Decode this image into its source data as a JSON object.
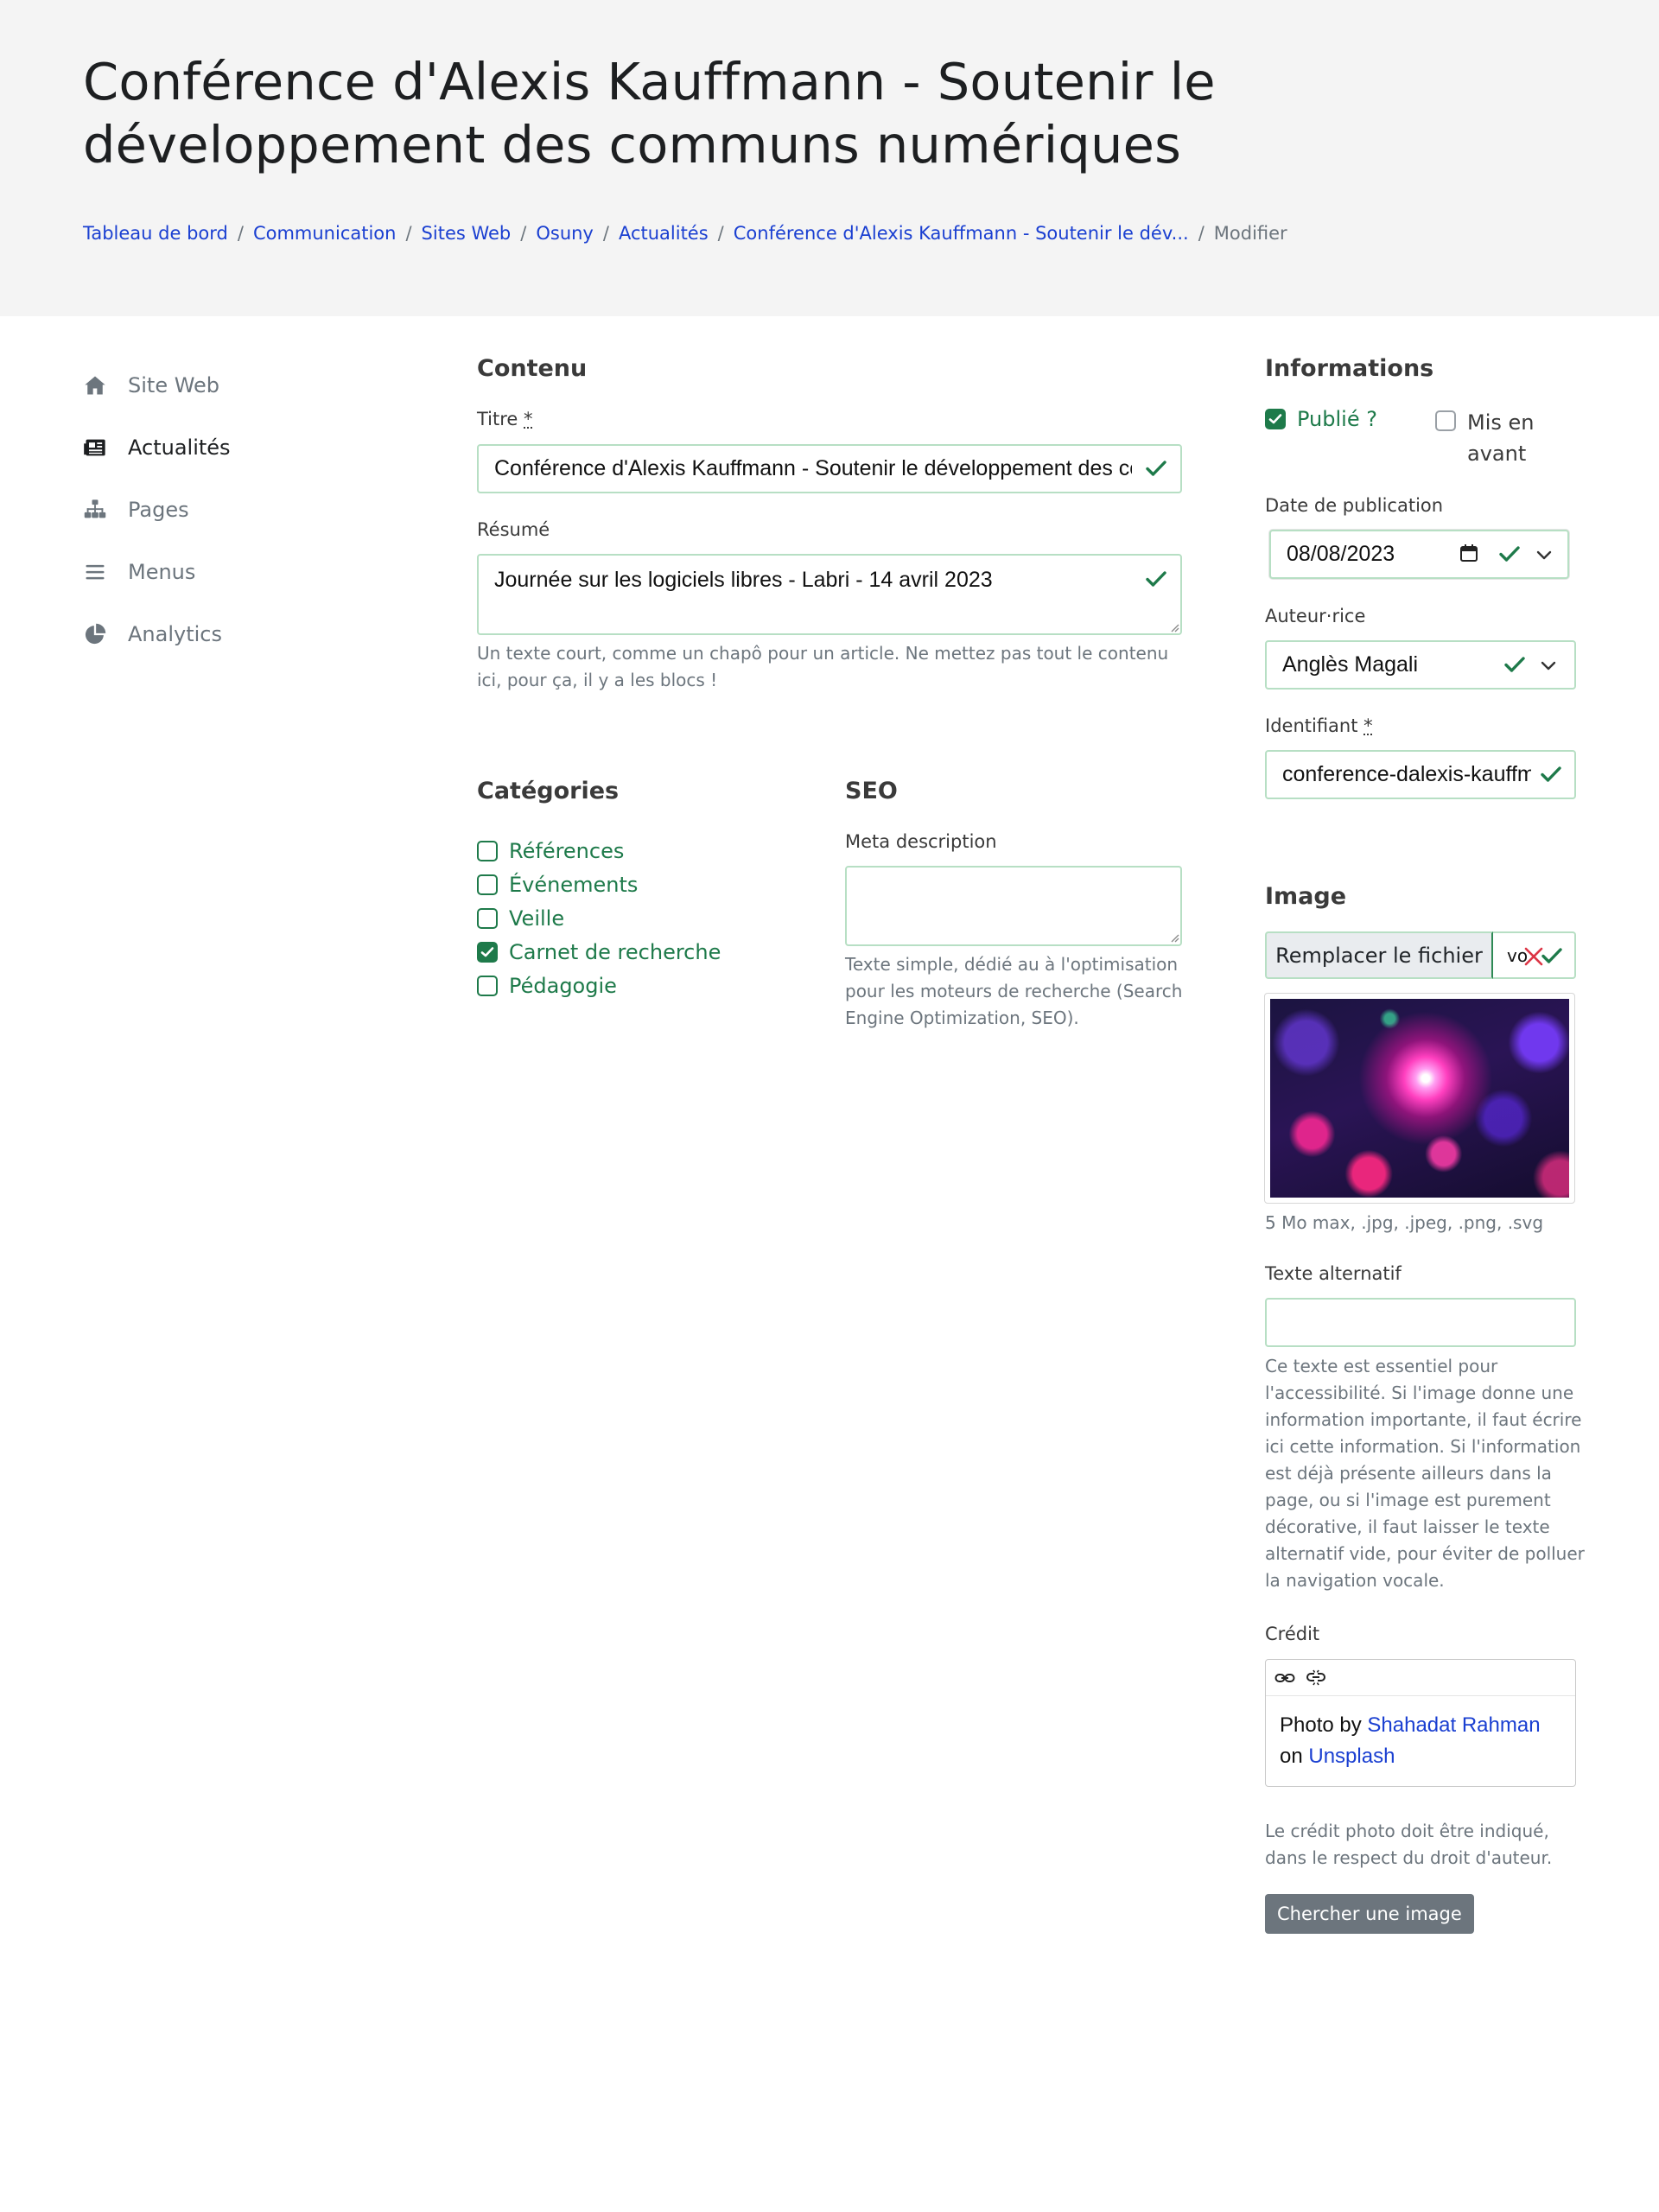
{
  "page": {
    "title": "Conférence d'Alexis Kauffmann - Soutenir le développement des communs numériques"
  },
  "breadcrumb": {
    "items": [
      "Tableau de bord",
      "Communication",
      "Sites Web",
      "Osuny",
      "Actualités",
      "Conférence d'Alexis Kauffmann - Soutenir le dév..."
    ],
    "current": "Modifier",
    "separator": "/"
  },
  "sidebar": {
    "items": [
      {
        "label": "Site Web",
        "icon": "home-icon",
        "active": false
      },
      {
        "label": "Actualités",
        "icon": "newspaper-icon",
        "active": true
      },
      {
        "label": "Pages",
        "icon": "sitemap-icon",
        "active": false
      },
      {
        "label": "Menus",
        "icon": "bars-icon",
        "active": false
      },
      {
        "label": "Analytics",
        "icon": "pie-chart-icon",
        "active": false
      }
    ]
  },
  "content": {
    "heading": "Contenu",
    "title_label": "Titre",
    "required_mark": "*",
    "title_value": "Conférence d'Alexis Kauffmann - Soutenir le développement des communs numériques",
    "summary_label": "Résumé",
    "summary_value": "Journée sur les logiciels libres - Labri - 14 avril 2023",
    "summary_help": "Un texte court, comme un chapô pour un article. Ne mettez pas tout le contenu ici, pour ça, il y a les blocs !"
  },
  "categories": {
    "heading": "Catégories",
    "items": [
      {
        "label": "Références",
        "checked": false
      },
      {
        "label": "Événements",
        "checked": false
      },
      {
        "label": "Veille",
        "checked": false
      },
      {
        "label": "Carnet de recherche",
        "checked": true
      },
      {
        "label": "Pédagogie",
        "checked": false
      }
    ]
  },
  "seo": {
    "heading": "SEO",
    "meta_label": "Meta description",
    "meta_value": "",
    "meta_help": "Texte simple, dédié au à l'optimisation pour les moteurs de recherche (Search Engine Optimization, SEO)."
  },
  "informations": {
    "heading": "Informations",
    "published_label": "Publié ?",
    "published": true,
    "featured_label": "Mis en avant",
    "featured": false,
    "date_label": "Date de publication",
    "date_value": "08/08/2023",
    "author_label": "Auteur·rice",
    "author_value": "Anglès Magali",
    "slug_label": "Identifiant",
    "slug_value": "conference-dalexis-kauffmann"
  },
  "image": {
    "heading": "Image",
    "replace_label": "Remplacer le fichier",
    "file_name": "vo",
    "formats_help": "5 Mo max, .jpg, .jpeg, .png, .svg",
    "alt_label": "Texte alternatif",
    "alt_value": "",
    "alt_help": "Ce texte est essentiel pour l'accessibilité. Si l'image donne une information importante, il faut écrire ici cette information. Si l'information est déjà présente ailleurs dans la page, ou si l'image est purement décorative, il faut laisser le texte alternatif vide, pour éviter de polluer la navigation vocale.",
    "credit_label": "Crédit",
    "credit": {
      "prefix": "Photo by",
      "author": "Shahadat Rahman",
      "middle": "on",
      "source": "Unsplash"
    },
    "credit_help": "Le crédit photo doit être indiqué, dans le respect du droit d'auteur.",
    "search_button": "Chercher une image"
  },
  "colors": {
    "success": "#1e7a4a",
    "link": "#1a3fd1",
    "muted": "#6c757d",
    "header_bg": "#f4f4f4",
    "danger": "#dc3545"
  }
}
